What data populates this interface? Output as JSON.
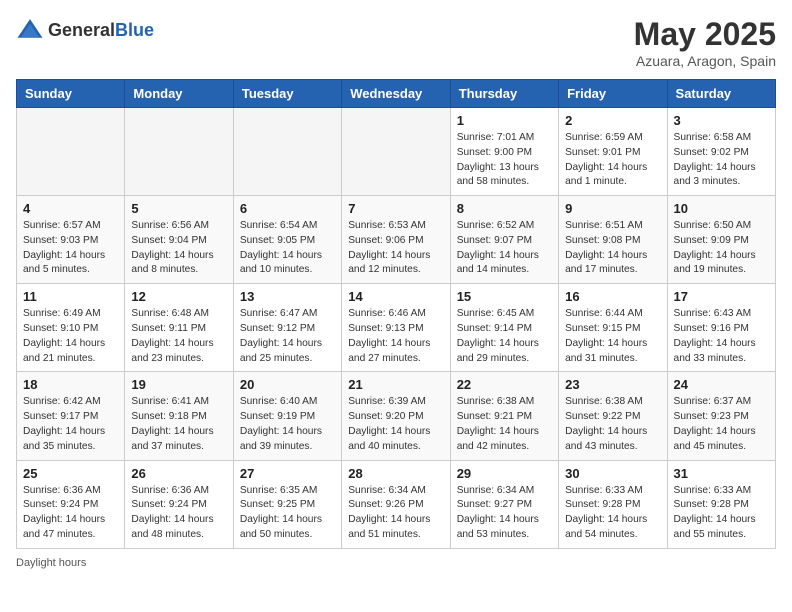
{
  "logo": {
    "general": "General",
    "blue": "Blue"
  },
  "header": {
    "month_year": "May 2025",
    "location": "Azuara, Aragon, Spain"
  },
  "days_of_week": [
    "Sunday",
    "Monday",
    "Tuesday",
    "Wednesday",
    "Thursday",
    "Friday",
    "Saturday"
  ],
  "footer": {
    "daylight_hours_label": "Daylight hours"
  },
  "weeks": [
    {
      "days": [
        {
          "date": "",
          "info": ""
        },
        {
          "date": "",
          "info": ""
        },
        {
          "date": "",
          "info": ""
        },
        {
          "date": "",
          "info": ""
        },
        {
          "date": "1",
          "info": "Sunrise: 7:01 AM\nSunset: 9:00 PM\nDaylight: 13 hours\nand 58 minutes."
        },
        {
          "date": "2",
          "info": "Sunrise: 6:59 AM\nSunset: 9:01 PM\nDaylight: 14 hours\nand 1 minute."
        },
        {
          "date": "3",
          "info": "Sunrise: 6:58 AM\nSunset: 9:02 PM\nDaylight: 14 hours\nand 3 minutes."
        }
      ]
    },
    {
      "days": [
        {
          "date": "4",
          "info": "Sunrise: 6:57 AM\nSunset: 9:03 PM\nDaylight: 14 hours\nand 5 minutes."
        },
        {
          "date": "5",
          "info": "Sunrise: 6:56 AM\nSunset: 9:04 PM\nDaylight: 14 hours\nand 8 minutes."
        },
        {
          "date": "6",
          "info": "Sunrise: 6:54 AM\nSunset: 9:05 PM\nDaylight: 14 hours\nand 10 minutes."
        },
        {
          "date": "7",
          "info": "Sunrise: 6:53 AM\nSunset: 9:06 PM\nDaylight: 14 hours\nand 12 minutes."
        },
        {
          "date": "8",
          "info": "Sunrise: 6:52 AM\nSunset: 9:07 PM\nDaylight: 14 hours\nand 14 minutes."
        },
        {
          "date": "9",
          "info": "Sunrise: 6:51 AM\nSunset: 9:08 PM\nDaylight: 14 hours\nand 17 minutes."
        },
        {
          "date": "10",
          "info": "Sunrise: 6:50 AM\nSunset: 9:09 PM\nDaylight: 14 hours\nand 19 minutes."
        }
      ]
    },
    {
      "days": [
        {
          "date": "11",
          "info": "Sunrise: 6:49 AM\nSunset: 9:10 PM\nDaylight: 14 hours\nand 21 minutes."
        },
        {
          "date": "12",
          "info": "Sunrise: 6:48 AM\nSunset: 9:11 PM\nDaylight: 14 hours\nand 23 minutes."
        },
        {
          "date": "13",
          "info": "Sunrise: 6:47 AM\nSunset: 9:12 PM\nDaylight: 14 hours\nand 25 minutes."
        },
        {
          "date": "14",
          "info": "Sunrise: 6:46 AM\nSunset: 9:13 PM\nDaylight: 14 hours\nand 27 minutes."
        },
        {
          "date": "15",
          "info": "Sunrise: 6:45 AM\nSunset: 9:14 PM\nDaylight: 14 hours\nand 29 minutes."
        },
        {
          "date": "16",
          "info": "Sunrise: 6:44 AM\nSunset: 9:15 PM\nDaylight: 14 hours\nand 31 minutes."
        },
        {
          "date": "17",
          "info": "Sunrise: 6:43 AM\nSunset: 9:16 PM\nDaylight: 14 hours\nand 33 minutes."
        }
      ]
    },
    {
      "days": [
        {
          "date": "18",
          "info": "Sunrise: 6:42 AM\nSunset: 9:17 PM\nDaylight: 14 hours\nand 35 minutes."
        },
        {
          "date": "19",
          "info": "Sunrise: 6:41 AM\nSunset: 9:18 PM\nDaylight: 14 hours\nand 37 minutes."
        },
        {
          "date": "20",
          "info": "Sunrise: 6:40 AM\nSunset: 9:19 PM\nDaylight: 14 hours\nand 39 minutes."
        },
        {
          "date": "21",
          "info": "Sunrise: 6:39 AM\nSunset: 9:20 PM\nDaylight: 14 hours\nand 40 minutes."
        },
        {
          "date": "22",
          "info": "Sunrise: 6:38 AM\nSunset: 9:21 PM\nDaylight: 14 hours\nand 42 minutes."
        },
        {
          "date": "23",
          "info": "Sunrise: 6:38 AM\nSunset: 9:22 PM\nDaylight: 14 hours\nand 43 minutes."
        },
        {
          "date": "24",
          "info": "Sunrise: 6:37 AM\nSunset: 9:23 PM\nDaylight: 14 hours\nand 45 minutes."
        }
      ]
    },
    {
      "days": [
        {
          "date": "25",
          "info": "Sunrise: 6:36 AM\nSunset: 9:24 PM\nDaylight: 14 hours\nand 47 minutes."
        },
        {
          "date": "26",
          "info": "Sunrise: 6:36 AM\nSunset: 9:24 PM\nDaylight: 14 hours\nand 48 minutes."
        },
        {
          "date": "27",
          "info": "Sunrise: 6:35 AM\nSunset: 9:25 PM\nDaylight: 14 hours\nand 50 minutes."
        },
        {
          "date": "28",
          "info": "Sunrise: 6:34 AM\nSunset: 9:26 PM\nDaylight: 14 hours\nand 51 minutes."
        },
        {
          "date": "29",
          "info": "Sunrise: 6:34 AM\nSunset: 9:27 PM\nDaylight: 14 hours\nand 53 minutes."
        },
        {
          "date": "30",
          "info": "Sunrise: 6:33 AM\nSunset: 9:28 PM\nDaylight: 14 hours\nand 54 minutes."
        },
        {
          "date": "31",
          "info": "Sunrise: 6:33 AM\nSunset: 9:28 PM\nDaylight: 14 hours\nand 55 minutes."
        }
      ]
    }
  ]
}
